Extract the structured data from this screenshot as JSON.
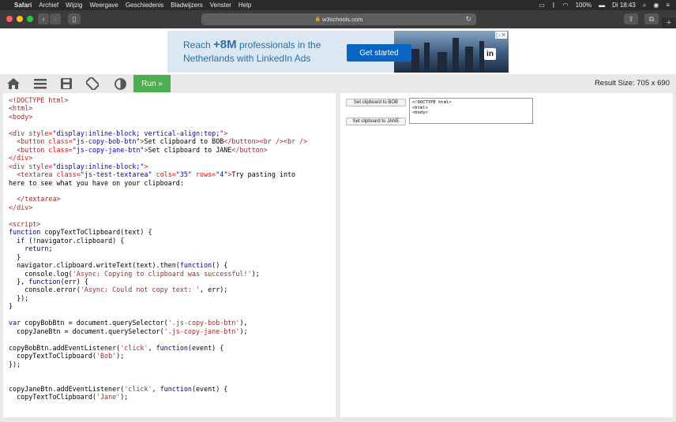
{
  "menubar": {
    "app": "Safari",
    "items": [
      "Archief",
      "Wijzig",
      "Weergave",
      "Geschiedenis",
      "Bladwijzers",
      "Venster",
      "Help"
    ],
    "battery": "100%",
    "clock": "Di 18:43"
  },
  "browser": {
    "url": "w3schools.com"
  },
  "ad": {
    "line1_pre": "Reach ",
    "line1_big": "+8M",
    "line1_post": " professionals in the",
    "line2": "Netherlands with LinkedIn Ads",
    "cta": "Get started",
    "logo": "in"
  },
  "toolbar": {
    "run_label": "Run »",
    "result_size": "Result Size: 705 x 690",
    "icons": [
      "home-icon",
      "menu-icon",
      "save-icon",
      "rotate-icon",
      "contrast-icon"
    ]
  },
  "result": {
    "button_bob": "Set clipboard to BOB",
    "button_jane": "Set clipboard to JANE",
    "textarea_value": "<!DOCTYPE html>\n<html>\n<body>"
  },
  "code": {
    "l01": "<!DOCTYPE html>",
    "l02": "<html>",
    "l03": "<body>",
    "l05a": "<div",
    "l05b": " style=",
    "l05c": "\"display:inline-block; vertical-align:top;\"",
    "l05d": ">",
    "l06a": "  <button",
    "l06b": " class=",
    "l06c": "\"js-copy-bob-btn\"",
    "l06d": ">",
    "l06e": "Set clipboard to BOB",
    "l06f": "</button><br /><br />",
    "l07a": "  <button",
    "l07b": " class=",
    "l07c": "\"js-copy-jane-btn\"",
    "l07d": ">",
    "l07e": "Set clipboard to JANE",
    "l07f": "</button>",
    "l08": "</div>",
    "l09a": "<div",
    "l09b": " style=",
    "l09c": "\"display:inline-block;\"",
    "l09d": ">",
    "l10a": "  <textarea",
    "l10b": " class=",
    "l10c": "\"js-test-textarea\"",
    "l10d": " cols=",
    "l10e": "\"35\"",
    "l10f": " rows=",
    "l10g": "\"4\"",
    "l10h": ">",
    "l10i": "Try pasting into",
    "l11": "here to see what you have on your clipboard:",
    "l13": "  </textarea>",
    "l14": "</div>",
    "l16": "<script>",
    "l17a": "function",
    "l17b": " copyTextToClipboard(text) {",
    "l18a": "  ",
    "l18b": "if",
    "l18c": " (!navigator.clipboard) {",
    "l19a": "    ",
    "l19b": "return",
    "l19c": ";",
    "l20": "  }",
    "l21a": "  navigator.clipboard.writeText(text).then(",
    "l21b": "function",
    "l21c": "() {",
    "l22a": "    console.log(",
    "l22b": "'Async: Copying to clipboard was successful!'",
    "l22c": ");",
    "l23a": "  }, ",
    "l23b": "function",
    "l23c": "(err) {",
    "l24a": "    console.error(",
    "l24b": "'Async: Could not copy text: '",
    "l24c": ", err);",
    "l25": "  });",
    "l26": "}",
    "l28a": "var",
    "l28b": " copyBobBtn = document.querySelector(",
    "l28c": "'.js-copy-bob-btn'",
    "l28d": "),",
    "l29a": "  copyJaneBtn = document.querySelector(",
    "l29b": "'.js-copy-jane-btn'",
    "l29c": ");",
    "l31a": "copyBobBtn.addEventListener(",
    "l31b": "'click'",
    "l31c": ", ",
    "l31d": "function",
    "l31e": "(event) {",
    "l32a": "  copyTextToClipboard(",
    "l32b": "'Bob'",
    "l32c": ");",
    "l33": "});",
    "l36a": "copyJaneBtn.addEventListener(",
    "l36b": "'click'",
    "l36c": ", ",
    "l36d": "function",
    "l36e": "(event) {",
    "l37a": "  copyTextToClipboard(",
    "l37b": "'Jane'",
    "l37c": ");"
  }
}
